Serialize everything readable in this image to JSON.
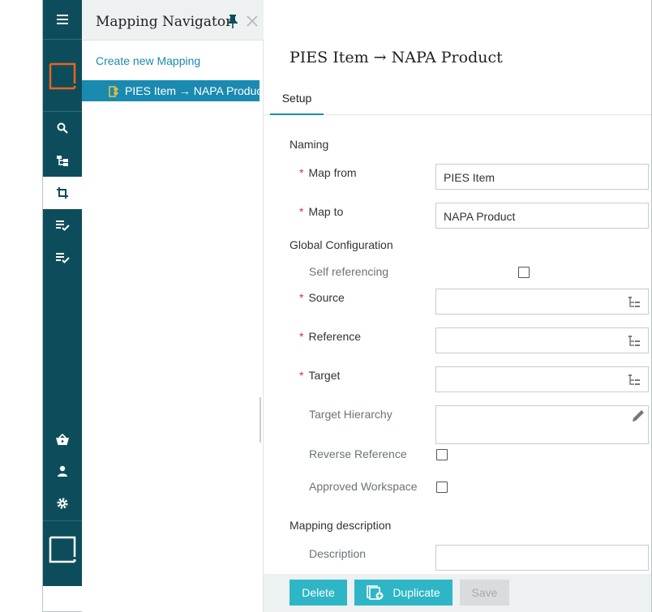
{
  "navigator": {
    "title": "Mapping Navigator",
    "create_link": "Create new Mapping",
    "items": [
      {
        "label": "PIES Item → NAPA Product",
        "selected": true
      }
    ]
  },
  "rail": {
    "top_icons": [
      "menu-icon",
      "logo-icon",
      "search-icon",
      "hierarchy-icon",
      "crop-icon",
      "checklist-icon",
      "checklist-alt-icon"
    ],
    "bottom_icons": [
      "basket-icon",
      "user-icon",
      "gear-icon",
      "square-logo-icon"
    ]
  },
  "main": {
    "title": "PIES Item → NAPA Product",
    "tabs": [
      {
        "label": "Setup",
        "active": true
      }
    ],
    "form": {
      "naming_section": "Naming",
      "map_from_label": "Map from",
      "map_from_value": "PIES Item",
      "map_to_label": "Map to",
      "map_to_value": "NAPA Product",
      "global_section": "Global Configuration",
      "self_ref_label": "Self referencing",
      "self_ref_checked": false,
      "source_label": "Source",
      "source_value": "",
      "reference_label": "Reference",
      "reference_value": "",
      "target_label": "Target",
      "target_value": "",
      "target_hierarchy_label": "Target Hierarchy",
      "reverse_ref_label": "Reverse Reference",
      "reverse_ref_checked": false,
      "approved_ws_label": "Approved Workspace",
      "approved_ws_checked": false,
      "description_section": "Mapping description",
      "description_label": "Description",
      "description_value": ""
    }
  },
  "footer": {
    "delete_label": "Delete",
    "duplicate_label": "Duplicate",
    "save_label": "Save"
  },
  "colors": {
    "rail_bg": "#0d4d5b",
    "accent": "#1a8ab0",
    "button": "#2eb6c6",
    "required": "#d63333",
    "logo_orange": "#e8641e"
  }
}
